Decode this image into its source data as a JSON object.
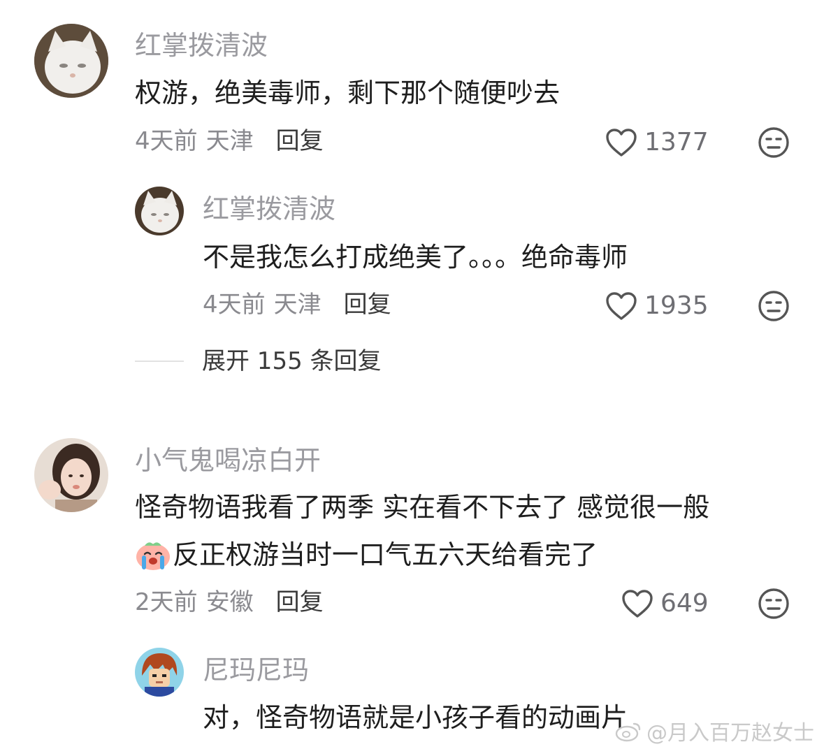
{
  "comments": [
    {
      "username": "红掌拨清波",
      "text": "权游，绝美毒师，剩下那个随便吵去",
      "time": "4天前",
      "location": "天津",
      "reply_label": "回复",
      "likes": "1377",
      "replies": [
        {
          "username": "红掌拨清波",
          "text": "不是我怎么打成绝美了。。。绝命毒师",
          "time": "4天前",
          "location": "天津",
          "reply_label": "回复",
          "likes": "1935"
        }
      ],
      "expand_label": "展开 155 条回复"
    },
    {
      "username": "小气鬼喝凉白开",
      "text_line1": "怪奇物语我看了两季 实在看不下去了 感觉很一般",
      "text_line2": "反正权游当时一口气五六天给看完了",
      "time": "2天前",
      "location": "安徽",
      "reply_label": "回复",
      "likes": "649",
      "replies": [
        {
          "username": "尼玛尼玛",
          "text": "对，怪奇物语就是小孩子看的动画片"
        }
      ]
    }
  ],
  "watermark": "@月入百万赵女士",
  "icons": {
    "like": "heart-outline-icon",
    "dislike": "meh-face-icon",
    "emoji": "crying-emoji-icon"
  }
}
